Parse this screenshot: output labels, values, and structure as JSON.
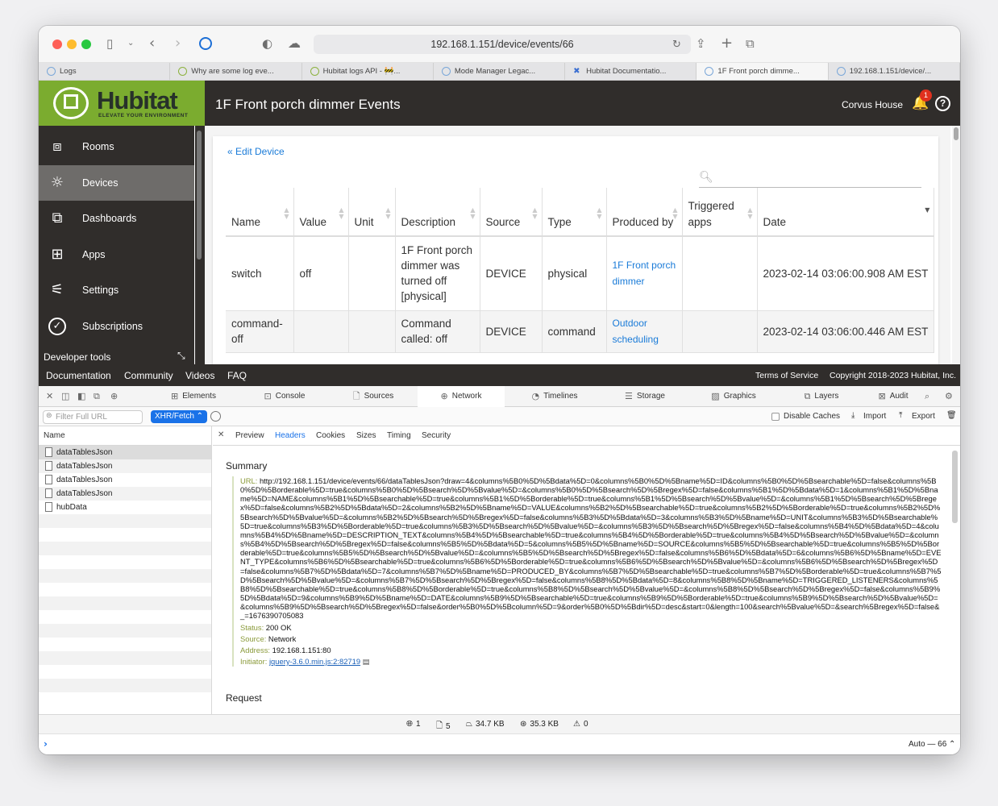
{
  "browser": {
    "url": "192.168.1.151/device/events/66",
    "tabs": [
      {
        "label": "Logs",
        "active": false
      },
      {
        "label": "Why are some log eve...",
        "active": false
      },
      {
        "label": "Hubitat logs API - 🚧...",
        "active": false
      },
      {
        "label": "Mode Manager Legac...",
        "active": false
      },
      {
        "label": "Hubitat Documentatio...",
        "active": false
      },
      {
        "label": "1F Front porch dimme...",
        "active": true
      },
      {
        "label": "192.168.1.151/device/...",
        "active": false
      }
    ]
  },
  "header": {
    "logo_text": "Hubitat",
    "logo_tagline": "ELEVATE YOUR ENVIRONMENT",
    "page_title": "1F Front porch dimmer Events",
    "hub_name": "Corvus House",
    "notification_count": "1"
  },
  "sidebar": {
    "items": [
      {
        "label": "Rooms",
        "icon": "rooms-icon"
      },
      {
        "label": "Devices",
        "icon": "devices-icon",
        "active": true
      },
      {
        "label": "Dashboards",
        "icon": "dashboards-icon"
      },
      {
        "label": "Apps",
        "icon": "apps-icon"
      },
      {
        "label": "Settings",
        "icon": "settings-icon"
      },
      {
        "label": "Subscriptions",
        "icon": "subscriptions-icon"
      }
    ],
    "developer_tools": "Developer tools"
  },
  "content": {
    "edit_link": "« Edit Device",
    "columns": [
      "Name",
      "Value",
      "Unit",
      "Description",
      "Source",
      "Type",
      "Produced by",
      "Triggered apps",
      "Date"
    ],
    "rows": [
      {
        "name": "switch",
        "value": "off",
        "unit": "",
        "description": "1F Front porch dimmer was turned off [physical]",
        "source": "DEVICE",
        "type": "physical",
        "produced_by": "1F Front porch dimmer",
        "triggered_apps": "",
        "date": "2023-02-14 03:06:00.908 AM EST"
      },
      {
        "name": "command-off",
        "value": "",
        "unit": "",
        "description": "Command called: off",
        "source": "DEVICE",
        "type": "command",
        "produced_by": "Outdoor scheduling",
        "triggered_apps": "",
        "date": "2023-02-14 03:06:00.446 AM EST"
      }
    ]
  },
  "footer": {
    "links": [
      "Documentation",
      "Community",
      "Videos",
      "FAQ"
    ],
    "terms": "Terms of Service",
    "copyright": "Copyright 2018-2023 Hubitat, Inc."
  },
  "devtools": {
    "tabs": [
      "Elements",
      "Console",
      "Sources",
      "Network",
      "Timelines",
      "Storage",
      "Graphics",
      "Layers",
      "Audit"
    ],
    "active_tab": "Network",
    "filter_placeholder": "Filter Full URL",
    "type_filter": "XHR/Fetch",
    "disable_caches": "Disable Caches",
    "import": "Import",
    "export": "Export",
    "list_header": "Name",
    "requests": [
      "dataTablesJson",
      "dataTablesJson",
      "dataTablesJson",
      "dataTablesJson",
      "hubData"
    ],
    "detail_tabs": [
      "Preview",
      "Headers",
      "Cookies",
      "Sizes",
      "Timing",
      "Security"
    ],
    "active_detail_tab": "Headers",
    "summary_title": "Summary",
    "url_label": "URL:",
    "url_value": "http://192.168.1.151/device/events/66/dataTablesJson?draw=4&columns%5B0%5D%5Bdata%5D=0&columns%5B0%5D%5Bname%5D=ID&columns%5B0%5D%5Bsearchable%5D=false&columns%5B0%5D%5Borderable%5D=true&columns%5B0%5D%5Bsearch%5D%5Bvalue%5D=&columns%5B0%5D%5Bsearch%5D%5Bregex%5D=false&columns%5B1%5D%5Bdata%5D=1&columns%5B1%5D%5Bname%5D=NAME&columns%5B1%5D%5Bsearchable%5D=true&columns%5B1%5D%5Borderable%5D=true&columns%5B1%5D%5Bsearch%5D%5Bvalue%5D=&columns%5B1%5D%5Bsearch%5D%5Bregex%5D=false&columns%5B2%5D%5Bdata%5D=2&columns%5B2%5D%5Bname%5D=VALUE&columns%5B2%5D%5Bsearchable%5D=true&columns%5B2%5D%5Borderable%5D=true&columns%5B2%5D%5Bsearch%5D%5Bvalue%5D=&columns%5B2%5D%5Bsearch%5D%5Bregex%5D=false&columns%5B3%5D%5Bdata%5D=3&columns%5B3%5D%5Bname%5D=UNIT&columns%5B3%5D%5Bsearchable%5D=true&columns%5B3%5D%5Borderable%5D=true&columns%5B3%5D%5Bsearch%5D%5Bvalue%5D=&columns%5B3%5D%5Bsearch%5D%5Bregex%5D=false&columns%5B4%5D%5Bdata%5D=4&columns%5B4%5D%5Bname%5D=DESCRIPTION_TEXT&columns%5B4%5D%5Bsearchable%5D=true&columns%5B4%5D%5Borderable%5D=true&columns%5B4%5D%5Bsearch%5D%5Bvalue%5D=&columns%5B4%5D%5Bsearch%5D%5Bregex%5D=false&columns%5B5%5D%5Bdata%5D=5&columns%5B5%5D%5Bname%5D=SOURCE&columns%5B5%5D%5Bsearchable%5D=true&columns%5B5%5D%5Borderable%5D=true&columns%5B5%5D%5Bsearch%5D%5Bvalue%5D=&columns%5B5%5D%5Bsearch%5D%5Bregex%5D=false&columns%5B6%5D%5Bdata%5D=6&columns%5B6%5D%5Bname%5D=EVENT_TYPE&columns%5B6%5D%5Bsearchable%5D=true&columns%5B6%5D%5Borderable%5D=true&columns%5B6%5D%5Bsearch%5D%5Bvalue%5D=&columns%5B6%5D%5Bsearch%5D%5Bregex%5D=false&columns%5B7%5D%5Bdata%5D=7&columns%5B7%5D%5Bname%5D=PRODUCED_BY&columns%5B7%5D%5Bsearchable%5D=true&columns%5B7%5D%5Borderable%5D=true&columns%5B7%5D%5Bsearch%5D%5Bvalue%5D=&columns%5B7%5D%5Bsearch%5D%5Bregex%5D=false&columns%5B8%5D%5Bdata%5D=8&columns%5B8%5D%5Bname%5D=TRIGGERED_LISTENERS&columns%5B8%5D%5Bsearchable%5D=true&columns%5B8%5D%5Borderable%5D=true&columns%5B8%5D%5Bsearch%5D%5Bvalue%5D=&columns%5B8%5D%5Bsearch%5D%5Bregex%5D=false&columns%5B9%5D%5Bdata%5D=9&columns%5B9%5D%5Bname%5D=DATE&columns%5B9%5D%5Bsearchable%5D=true&columns%5B9%5D%5Borderable%5D=true&columns%5B9%5D%5Bsearch%5D%5Bvalue%5D=&columns%5B9%5D%5Bsearch%5D%5Bregex%5D=false&order%5B0%5D%5Bcolumn%5D=9&order%5B0%5D%5Bdir%5D=desc&start=0&length=100&search%5Bvalue%5D=&search%5Bregex%5D=false&_=1676390705083",
    "status_label": "Status:",
    "status_value": "200 OK",
    "source_label": "Source:",
    "source_value": "Network",
    "address_label": "Address:",
    "address_value": "192.168.1.151:80",
    "initiator_label": "Initiator:",
    "initiator_value": "jquery-3.6.0.min.js:2:82719",
    "request_title": "Request",
    "stats": {
      "requests": "1",
      "resources": "5",
      "transferred": "34.7 KB",
      "size": "35.3 KB",
      "errors": "0"
    },
    "console_mode": "Auto — 66 ⌃"
  }
}
